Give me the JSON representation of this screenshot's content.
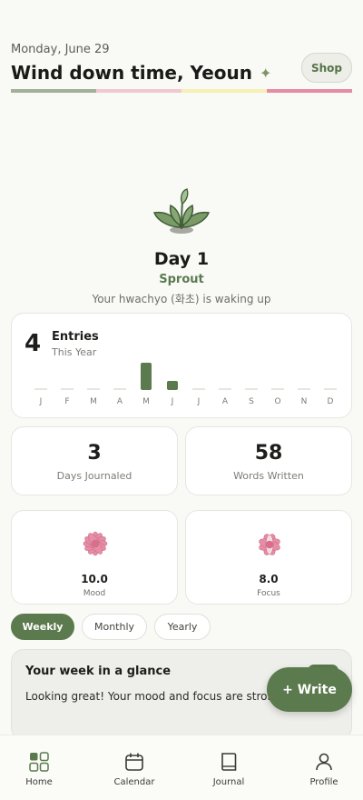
{
  "header": {
    "date": "Monday, June 29",
    "greeting": "Wind down time, Yeoun",
    "sparkle_icon": "sparkle-icon",
    "shop_label": "Shop",
    "stripe_colors": [
      "#a2b098",
      "#f1c8cf",
      "#f6f0b6",
      "#e48ca3"
    ]
  },
  "plant": {
    "icon": "sprout-plant-icon",
    "day": "Day 1",
    "stage": "Sprout",
    "subtitle": "Your hwachyo (화초) is waking up"
  },
  "entries": {
    "count": "4",
    "label": "Entries",
    "sublabel": "This Year",
    "months": [
      {
        "label": "J",
        "value": 0
      },
      {
        "label": "F",
        "value": 0
      },
      {
        "label": "M",
        "value": 0
      },
      {
        "label": "A",
        "value": 0
      },
      {
        "label": "M",
        "value": 3
      },
      {
        "label": "J",
        "value": 1
      },
      {
        "label": "J",
        "value": 0
      },
      {
        "label": "A",
        "value": 0
      },
      {
        "label": "S",
        "value": 0
      },
      {
        "label": "O",
        "value": 0
      },
      {
        "label": "N",
        "value": 0
      },
      {
        "label": "D",
        "value": 0
      }
    ]
  },
  "stats": {
    "days_journaled": {
      "value": "3",
      "label": "Days Journaled"
    },
    "words_written": {
      "value": "58",
      "label": "Words Written"
    }
  },
  "scores": {
    "mood": {
      "value": "10.0",
      "label": "Mood",
      "icon": "pink-flower-icon"
    },
    "focus": {
      "value": "8.0",
      "label": "Focus",
      "icon": "pink-flower-icon"
    }
  },
  "period_tabs": [
    {
      "label": "Weekly",
      "active": true
    },
    {
      "label": "Monthly",
      "active": false
    },
    {
      "label": "Yearly",
      "active": false
    }
  ],
  "glance": {
    "title": "Your week in a glance",
    "body": "Looking great! Your mood and focus are strong"
  },
  "write_button": "+ Write",
  "nav": [
    {
      "label": "Home",
      "icon": "home-grid-icon",
      "active": true
    },
    {
      "label": "Calendar",
      "icon": "calendar-icon",
      "active": false
    },
    {
      "label": "Journal",
      "icon": "book-icon",
      "active": false
    },
    {
      "label": "Profile",
      "icon": "person-icon",
      "active": false
    }
  ],
  "colors": {
    "accent": "#5b7a4e",
    "flower": "#e58ea6",
    "background": "#f9f9f6"
  }
}
